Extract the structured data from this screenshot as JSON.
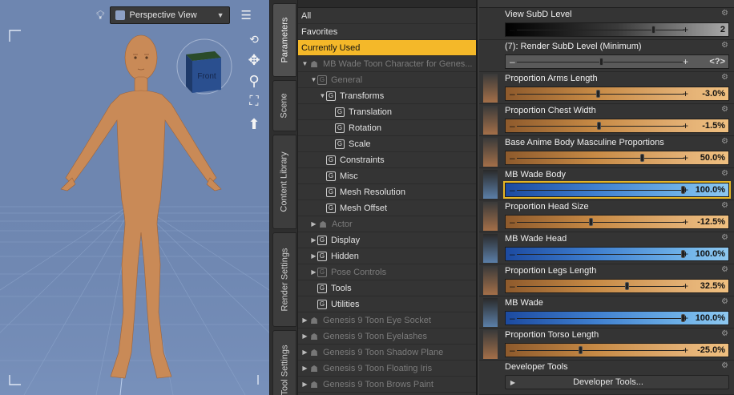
{
  "viewport": {
    "camera_label": "Perspective View",
    "navcube_label": "Front"
  },
  "side_tabs": [
    {
      "label": "Parameters",
      "active": true
    },
    {
      "label": "Scene",
      "active": false
    },
    {
      "label": "Content Library",
      "active": false
    },
    {
      "label": "Render Settings",
      "active": false
    },
    {
      "label": "Tool Settings",
      "active": false
    }
  ],
  "tree": {
    "rows": [
      {
        "label": "All",
        "indent": 0,
        "arrow": "",
        "icon": "",
        "dim": false,
        "selected": false
      },
      {
        "label": "Favorites",
        "indent": 0,
        "arrow": "",
        "icon": "",
        "dim": false,
        "selected": false
      },
      {
        "label": "Currently Used",
        "indent": 0,
        "arrow": "",
        "icon": "",
        "dim": false,
        "selected": true
      },
      {
        "label": "MB Wade Toon Character for Genes...",
        "indent": 0,
        "arrow": "▼",
        "icon": "person",
        "dim": true,
        "selected": false
      },
      {
        "label": "General",
        "indent": 1,
        "arrow": "▼",
        "icon": "G",
        "dim": true,
        "selected": false
      },
      {
        "label": "Transforms",
        "indent": 2,
        "arrow": "▼",
        "icon": "G",
        "dim": false,
        "selected": false
      },
      {
        "label": "Translation",
        "indent": 3,
        "arrow": "",
        "icon": "G",
        "dim": false,
        "selected": false
      },
      {
        "label": "Rotation",
        "indent": 3,
        "arrow": "",
        "icon": "G",
        "dim": false,
        "selected": false
      },
      {
        "label": "Scale",
        "indent": 3,
        "arrow": "",
        "icon": "G",
        "dim": false,
        "selected": false
      },
      {
        "label": "Constraints",
        "indent": 2,
        "arrow": "",
        "icon": "G",
        "dim": false,
        "selected": false
      },
      {
        "label": "Misc",
        "indent": 2,
        "arrow": "",
        "icon": "G",
        "dim": false,
        "selected": false
      },
      {
        "label": "Mesh Resolution",
        "indent": 2,
        "arrow": "",
        "icon": "G",
        "dim": false,
        "selected": false
      },
      {
        "label": "Mesh Offset",
        "indent": 2,
        "arrow": "",
        "icon": "G",
        "dim": false,
        "selected": false
      },
      {
        "label": "Actor",
        "indent": 1,
        "arrow": "▶",
        "icon": "person",
        "dim": true,
        "selected": false
      },
      {
        "label": "Display",
        "indent": 1,
        "arrow": "▶",
        "icon": "G",
        "dim": false,
        "selected": false
      },
      {
        "label": "Hidden",
        "indent": 1,
        "arrow": "▶",
        "icon": "G",
        "dim": false,
        "selected": false
      },
      {
        "label": "Pose Controls",
        "indent": 1,
        "arrow": "▶",
        "icon": "G",
        "dim": true,
        "selected": false
      },
      {
        "label": "Tools",
        "indent": 1,
        "arrow": "",
        "icon": "G",
        "dim": false,
        "selected": false
      },
      {
        "label": "Utilities",
        "indent": 1,
        "arrow": "",
        "icon": "G",
        "dim": false,
        "selected": false
      },
      {
        "label": "Genesis 9 Toon Eye Socket",
        "indent": 0,
        "arrow": "▶",
        "icon": "person",
        "dim": true,
        "selected": false
      },
      {
        "label": "Genesis 9 Toon Eyelashes",
        "indent": 0,
        "arrow": "▶",
        "icon": "person",
        "dim": true,
        "selected": false
      },
      {
        "label": "Genesis 9 Toon Shadow Plane",
        "indent": 0,
        "arrow": "▶",
        "icon": "person",
        "dim": true,
        "selected": false
      },
      {
        "label": "Genesis 9 Toon Floating Iris",
        "indent": 0,
        "arrow": "▶",
        "icon": "person",
        "dim": true,
        "selected": false
      },
      {
        "label": "Genesis 9 Toon Brows Paint",
        "indent": 0,
        "arrow": "▶",
        "icon": "person",
        "dim": true,
        "selected": false
      }
    ]
  },
  "properties": [
    {
      "name": "View SubD Level",
      "value": "2",
      "fraction": 0.82,
      "style": "dark",
      "thumb": false,
      "highlight": false
    },
    {
      "name": "(7): Render SubD Level (Minimum)",
      "value": "<?>",
      "fraction": 0.5,
      "style": "grey",
      "thumb": false,
      "highlight": false
    },
    {
      "name": "Proportion Arms Length",
      "value": "-3.0%",
      "fraction": 0.485,
      "style": "orange",
      "thumb": true,
      "highlight": false
    },
    {
      "name": "Proportion Chest Width",
      "value": "-1.5%",
      "fraction": 0.49,
      "style": "orange",
      "thumb": true,
      "highlight": false
    },
    {
      "name": "Base Anime Body Masculine Proportions",
      "value": "50.0%",
      "fraction": 0.75,
      "style": "orange",
      "thumb": true,
      "highlight": false
    },
    {
      "name": "MB Wade Body",
      "value": "100.0%",
      "fraction": 1.0,
      "style": "blue",
      "thumb": true,
      "highlight": true
    },
    {
      "name": "Proportion Head Size",
      "value": "-12.5%",
      "fraction": 0.44,
      "style": "orange",
      "thumb": true,
      "highlight": false
    },
    {
      "name": "MB Wade Head",
      "value": "100.0%",
      "fraction": 1.0,
      "style": "blue",
      "thumb": true,
      "highlight": false
    },
    {
      "name": "Proportion Legs Length",
      "value": "32.5%",
      "fraction": 0.66,
      "style": "orange",
      "thumb": true,
      "highlight": false
    },
    {
      "name": "MB Wade",
      "value": "100.0%",
      "fraction": 1.0,
      "style": "blue",
      "thumb": true,
      "highlight": false
    },
    {
      "name": "Proportion Torso Length",
      "value": "-25.0%",
      "fraction": 0.375,
      "style": "orange",
      "thumb": true,
      "highlight": false
    }
  ],
  "developer": {
    "group_label": "Developer Tools",
    "button_label": "Developer Tools..."
  },
  "colors": {
    "selected_row": "#f4b829",
    "viewport_bg": "#6e86b0",
    "skin": "#c98a57"
  }
}
